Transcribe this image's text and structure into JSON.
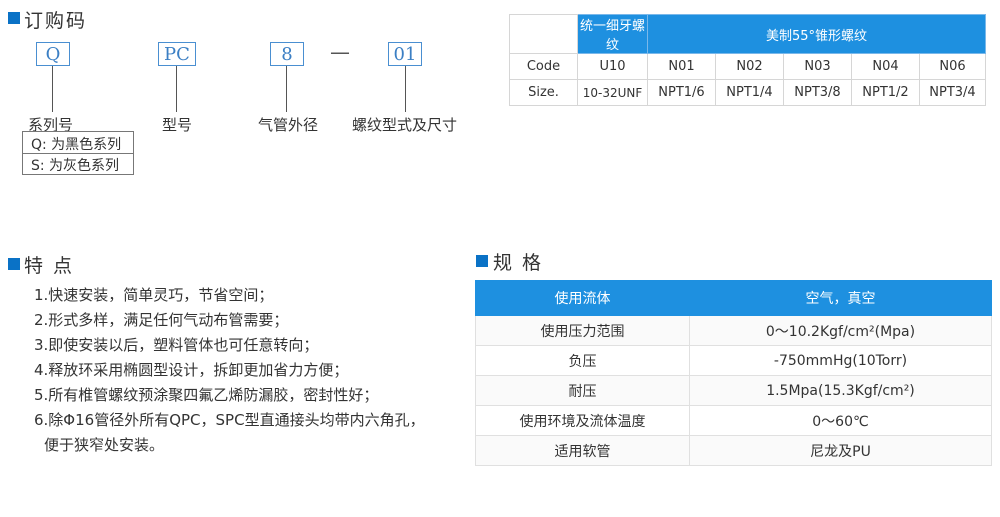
{
  "order": {
    "title": "订购码",
    "codes": [
      "Q",
      "PC",
      "8",
      "01"
    ],
    "dash": "—",
    "labels": [
      "系列号",
      "型号",
      "气管外径",
      "螺纹型式及尺寸"
    ],
    "series_options": [
      "Q: 为黑色系列",
      "S: 为灰色系列"
    ]
  },
  "code_table": {
    "header": [
      "统一细牙螺纹",
      "美制55°锥形螺纹"
    ],
    "rows": [
      [
        "Code",
        "U10",
        "N01",
        "N02",
        "N03",
        "N04",
        "N06"
      ],
      [
        "Size.",
        "10-32UNF",
        "NPT1/6",
        "NPT1/4",
        "NPT3/8",
        "NPT1/2",
        "NPT3/4"
      ]
    ]
  },
  "features": {
    "title": "特 点",
    "items": [
      "1.快速安装，简单灵巧，节省空间；",
      "2.形式多样，满足任何气动布管需要；",
      "3.即使安装以后，塑料管体也可任意转向；",
      "4.释放环采用椭圆型设计，拆卸更加省力方便；",
      "5.所有椎管螺纹预涂聚四氟乙烯防漏胶，密封性好；",
      "6.除Φ16管径外所有QPC，SPC型直通接头均带内六角孔，",
      "便于狭窄处安装。"
    ]
  },
  "spec": {
    "title": "规 格",
    "header": [
      "使用流体",
      "空气，真空"
    ],
    "rows": [
      [
        "使用压力范围",
        "0～10.2Kgf/cm²(Mpa)"
      ],
      [
        "负压",
        "-750mmHg(10Torr)"
      ],
      [
        "耐压",
        "1.5Mpa(15.3Kgf/cm²)"
      ],
      [
        "使用环境及流体温度",
        "0～60℃"
      ],
      [
        "适用软管",
        "尼龙及PU"
      ]
    ]
  },
  "colors": {
    "accent": "#1e90e0",
    "square": "#0a72c6",
    "code_text": "#3b7fc4"
  }
}
